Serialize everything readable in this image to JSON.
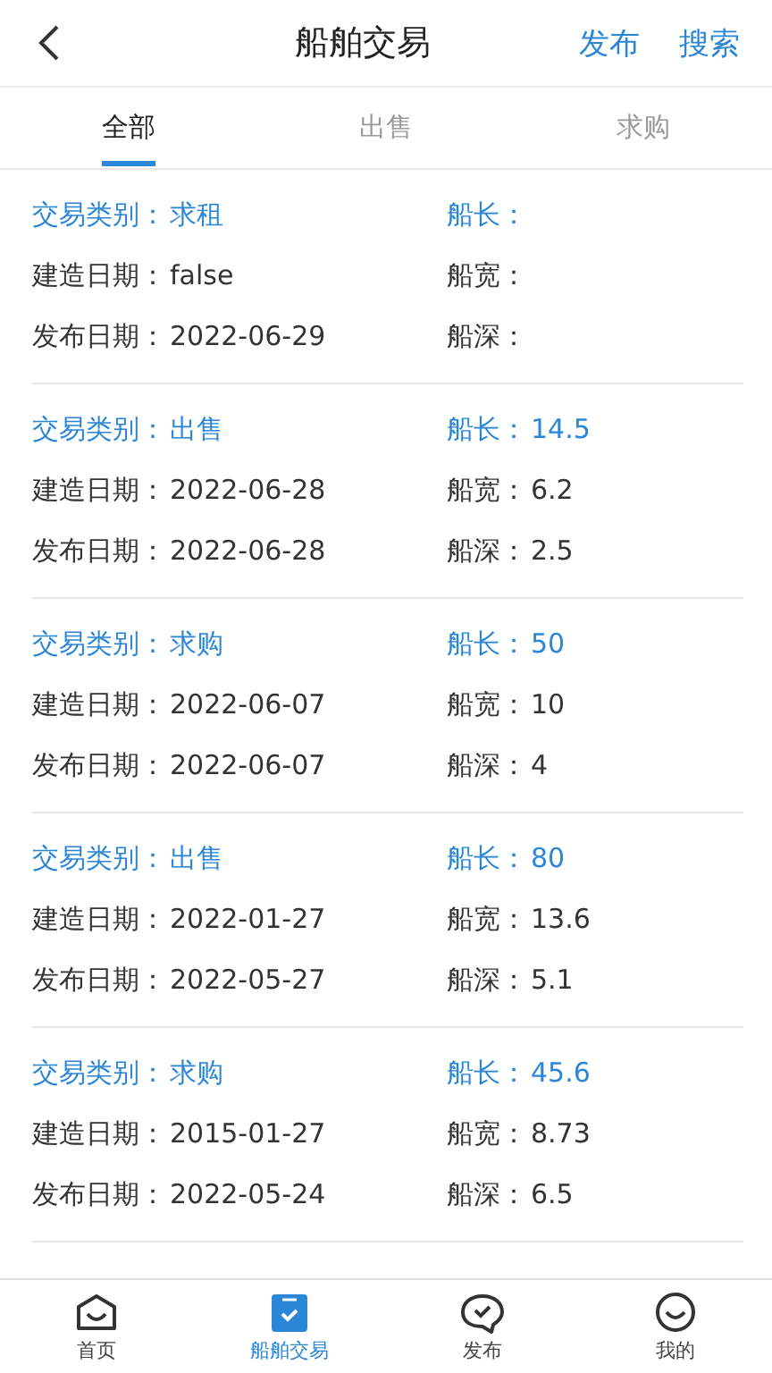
{
  "header": {
    "title": "船舶交易",
    "actions": [
      "发布",
      "搜索"
    ]
  },
  "tabs": [
    {
      "label": "全部",
      "selected": true
    },
    {
      "label": "出售",
      "selected": false
    },
    {
      "label": "求购",
      "selected": false
    }
  ],
  "listings": [
    {
      "fields": [
        {
          "kind": "accent",
          "label": "交易类别：",
          "value": "求租"
        },
        {
          "kind": "accent",
          "label": "船长："
        },
        {
          "kind": "plain",
          "label": "建造日期：",
          "value": "false"
        },
        {
          "kind": "plain",
          "label": "船宽："
        },
        {
          "kind": "plain",
          "label": "发布日期：",
          "value": "2022-06-29"
        },
        {
          "kind": "plain",
          "label": "船深："
        }
      ]
    },
    {
      "fields": [
        {
          "kind": "accent",
          "label": "交易类别：",
          "value": "出售"
        },
        {
          "kind": "accent",
          "label": "船长：",
          "value": "14.5"
        },
        {
          "kind": "plain",
          "label": "建造日期：",
          "value": "2022-06-28"
        },
        {
          "kind": "plain",
          "label": "船宽：",
          "value": "6.2"
        },
        {
          "kind": "plain",
          "label": "发布日期：",
          "value": "2022-06-28"
        },
        {
          "kind": "plain",
          "label": "船深：",
          "value": "2.5"
        }
      ]
    },
    {
      "fields": [
        {
          "kind": "accent",
          "label": "交易类别：",
          "value": "求购"
        },
        {
          "kind": "accent",
          "label": "船长：",
          "value": "50"
        },
        {
          "kind": "plain",
          "label": "建造日期：",
          "value": "2022-06-07"
        },
        {
          "kind": "plain",
          "label": "船宽：",
          "value": "10"
        },
        {
          "kind": "plain",
          "label": "发布日期：",
          "value": "2022-06-07"
        },
        {
          "kind": "plain",
          "label": "船深：",
          "value": "4"
        }
      ]
    },
    {
      "fields": [
        {
          "kind": "accent",
          "label": "交易类别：",
          "value": "出售"
        },
        {
          "kind": "accent",
          "label": "船长：",
          "value": "80"
        },
        {
          "kind": "plain",
          "label": "建造日期：",
          "value": "2022-01-27"
        },
        {
          "kind": "plain",
          "label": "船宽：",
          "value": "13.6"
        },
        {
          "kind": "plain",
          "label": "发布日期：",
          "value": "2022-05-27"
        },
        {
          "kind": "plain",
          "label": "船深：",
          "value": "5.1"
        }
      ]
    },
    {
      "fields": [
        {
          "kind": "accent",
          "label": "交易类别：",
          "value": "求购"
        },
        {
          "kind": "accent",
          "label": "船长：",
          "value": "45.6"
        },
        {
          "kind": "plain",
          "label": "建造日期：",
          "value": "2015-01-27"
        },
        {
          "kind": "plain",
          "label": "船宽：",
          "value": "8.73"
        },
        {
          "kind": "plain",
          "label": "发布日期：",
          "value": "2022-05-24"
        },
        {
          "kind": "plain",
          "label": "船深：",
          "value": "6.5"
        }
      ]
    }
  ],
  "nav": [
    {
      "kind": "home",
      "label": "首页",
      "selected": false
    },
    {
      "kind": "trade",
      "label": "船舶交易",
      "selected": true
    },
    {
      "kind": "chat",
      "label": "发布",
      "selected": false
    },
    {
      "kind": "me",
      "label": "我的",
      "selected": false
    }
  ]
}
